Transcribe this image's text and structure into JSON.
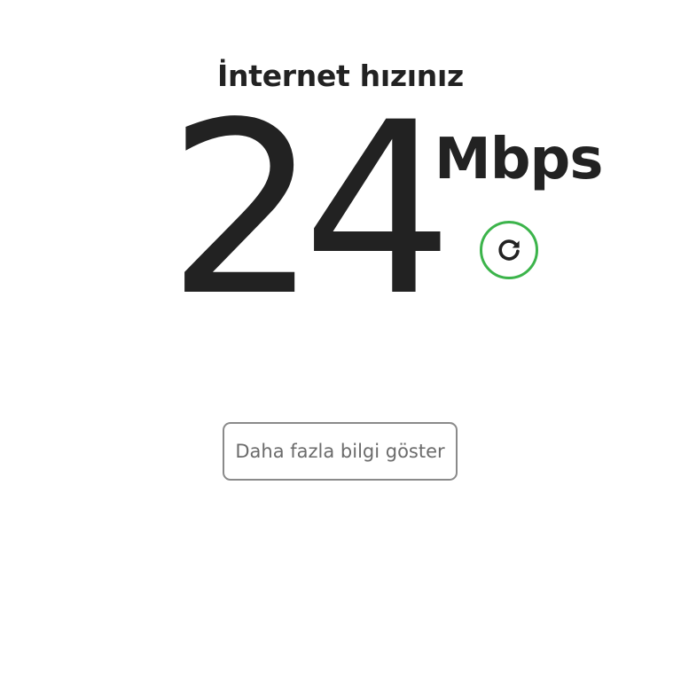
{
  "speed_test": {
    "heading": "İnternet hızınız",
    "value": "24",
    "unit": "Mbps",
    "refresh_icon": "refresh-icon",
    "more_info_label": "Daha fazla bilgi göster"
  },
  "colors": {
    "text": "#222222",
    "accent_green": "#3cb44b",
    "button_border": "#8a8a8a",
    "button_text": "#6b6b6b",
    "background": "#ffffff"
  }
}
